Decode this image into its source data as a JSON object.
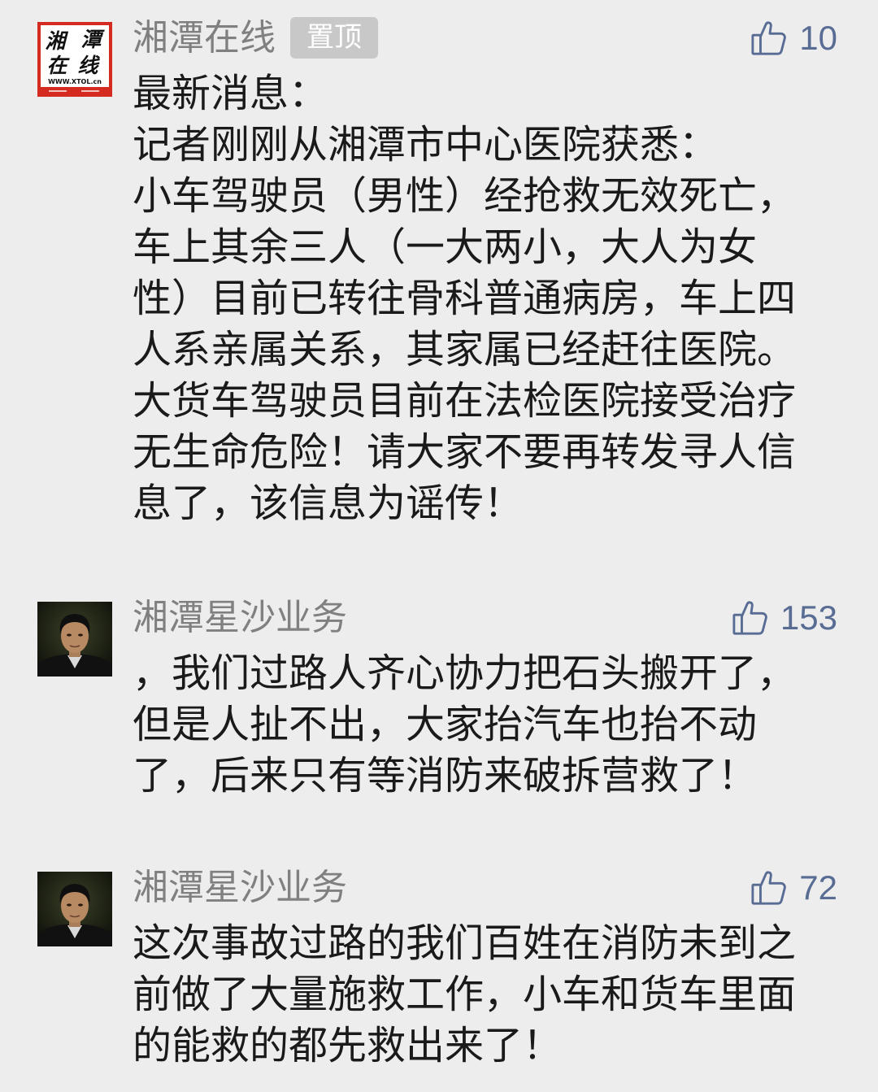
{
  "theme": {
    "background": "#ededed",
    "link_color": "#586c94",
    "name_color": "#808080",
    "text_color": "#1a1a1a",
    "badge_background": "#c8c8c8",
    "badge_text": "#ffffff",
    "logo_red": "#d42a1f"
  },
  "comments": [
    {
      "author": "湘潭在线",
      "avatar": {
        "type": "logo",
        "logo_chars": [
          "湘",
          "潭",
          "在",
          "线"
        ],
        "logo_url_text": "WWW.XTOL.cn"
      },
      "badge": "置顶",
      "like_icon": "thumbs-up-icon",
      "likes": 10,
      "lines": [
        "最新消息：",
        "记者刚刚从湘潭市中心医院获悉：",
        "小车驾驶员（男性）经抢救无效死亡，",
        "车上其余三人（一大两小，大人为女",
        "性）目前已转往骨科普通病房，车上四",
        "人系亲属关系，其家属已经赶往医院。",
        "大货车驾驶员目前在法检医院接受治疗",
        "无生命危险！请大家不要再转发寻人信",
        "息了，该信息为谣传！"
      ]
    },
    {
      "author": "湘潭星沙业务",
      "avatar": {
        "type": "photo",
        "icon": "person-photo"
      },
      "like_icon": "thumbs-up-icon",
      "likes": 153,
      "lines": [
        "，我们过路人齐心协力把石头搬开了，",
        "但是人扯不出，大家抬汽车也抬不动",
        "了，后来只有等消防来破拆营救了！"
      ]
    },
    {
      "author": "湘潭星沙业务",
      "avatar": {
        "type": "photo",
        "icon": "person-photo"
      },
      "like_icon": "thumbs-up-icon",
      "likes": 72,
      "lines": [
        "这次事故过路的我们百姓在消防未到之",
        "前做了大量施救工作，小车和货车里面",
        "的能救的都先救出来了！"
      ]
    }
  ]
}
